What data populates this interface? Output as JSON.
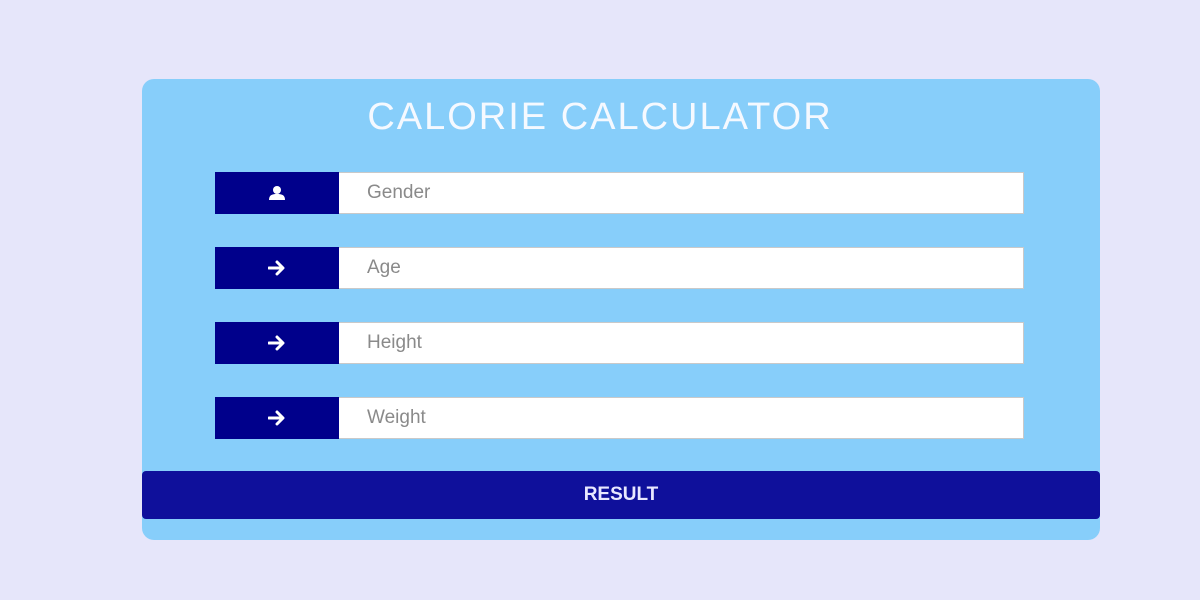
{
  "app": {
    "title": "CALORIE CALCULATOR"
  },
  "fields": [
    {
      "placeholder": "Gender",
      "icon": "user-icon",
      "value": ""
    },
    {
      "placeholder": "Age",
      "icon": "arrow-right-icon",
      "value": ""
    },
    {
      "placeholder": "Height",
      "icon": "arrow-right-icon",
      "value": ""
    },
    {
      "placeholder": "Weight",
      "icon": "arrow-right-icon",
      "value": ""
    }
  ],
  "actions": {
    "result_label": "RESULT"
  },
  "colors": {
    "page_background": "#e6e6fa",
    "card_background": "#87cefa",
    "icon_box": "#00008b",
    "button": "#0f109b",
    "title_text": "#f5f9ff"
  }
}
